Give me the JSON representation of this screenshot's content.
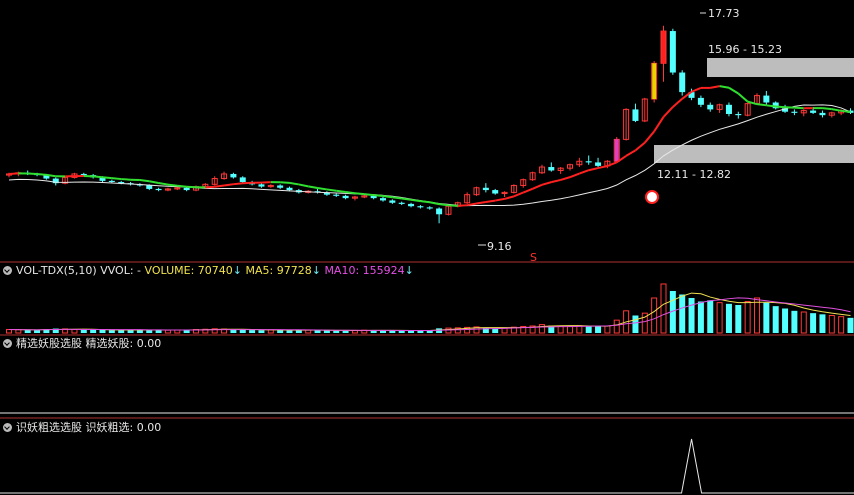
{
  "colors": {
    "up": "#ff3838",
    "down": "#54ffff",
    "ma_white": "#e8e8e8",
    "ma_yellow": "#f0e050",
    "ma_magenta": "#e050e0",
    "separator": "#b03030",
    "band": "#bdbdbd"
  },
  "price_pane": {
    "annotations": {
      "high": "17.73",
      "low": "9.16",
      "zone_upper": "15.96 - 15.23",
      "zone_lower": "12.11 - 12.82",
      "marker": "S"
    }
  },
  "volume_header": {
    "name": "VOL-TDX(5,10)",
    "vvol": "VVOL: -",
    "volume": "VOLUME: 70740",
    "ma5": "MA5: 97728",
    "ma10": "MA10: 155924"
  },
  "panel2_header": {
    "name": "精选妖股选股",
    "value": "精选妖股: 0.00"
  },
  "panel3_header": {
    "name": "识妖粗选选股",
    "value": "识妖粗选: 0.00"
  },
  "chart_data": {
    "type": "candlestick",
    "price_range": [
      8.0,
      18.5
    ],
    "candles": [
      [
        11.25,
        11.35,
        11.15,
        11.3
      ],
      [
        11.3,
        11.4,
        11.2,
        11.35
      ],
      [
        11.35,
        11.45,
        11.25,
        11.3
      ],
      [
        11.3,
        11.35,
        11.2,
        11.25
      ],
      [
        11.25,
        11.3,
        11.05,
        11.1
      ],
      [
        11.1,
        11.15,
        10.8,
        10.9
      ],
      [
        10.9,
        11.2,
        10.85,
        11.15
      ],
      [
        11.15,
        11.35,
        11.1,
        11.3
      ],
      [
        11.3,
        11.35,
        11.2,
        11.25
      ],
      [
        11.25,
        11.3,
        11.1,
        11.15
      ],
      [
        11.15,
        11.2,
        10.95,
        11.0
      ],
      [
        11.0,
        11.05,
        10.9,
        10.95
      ],
      [
        10.95,
        11.0,
        10.85,
        10.9
      ],
      [
        10.9,
        10.95,
        10.8,
        10.85
      ],
      [
        10.85,
        10.9,
        10.75,
        10.8
      ],
      [
        10.8,
        10.85,
        10.6,
        10.65
      ],
      [
        10.65,
        10.7,
        10.55,
        10.6
      ],
      [
        10.6,
        10.7,
        10.55,
        10.65
      ],
      [
        10.65,
        10.75,
        10.6,
        10.7
      ],
      [
        10.7,
        10.75,
        10.55,
        10.6
      ],
      [
        10.6,
        10.8,
        10.55,
        10.75
      ],
      [
        10.75,
        10.9,
        10.7,
        10.85
      ],
      [
        10.85,
        11.2,
        10.8,
        11.1
      ],
      [
        11.1,
        11.4,
        11.05,
        11.3
      ],
      [
        11.3,
        11.35,
        11.1,
        11.15
      ],
      [
        11.15,
        11.2,
        10.9,
        10.95
      ],
      [
        10.95,
        11.0,
        10.8,
        10.85
      ],
      [
        10.85,
        10.9,
        10.7,
        10.75
      ],
      [
        10.75,
        10.85,
        10.7,
        10.8
      ],
      [
        10.8,
        10.85,
        10.65,
        10.7
      ],
      [
        10.7,
        10.75,
        10.55,
        10.6
      ],
      [
        10.6,
        10.65,
        10.45,
        10.5
      ],
      [
        10.5,
        10.6,
        10.45,
        10.55
      ],
      [
        10.55,
        10.65,
        10.45,
        10.5
      ],
      [
        10.5,
        10.55,
        10.35,
        10.4
      ],
      [
        10.4,
        10.45,
        10.3,
        10.35
      ],
      [
        10.35,
        10.4,
        10.2,
        10.25
      ],
      [
        10.25,
        10.35,
        10.15,
        10.3
      ],
      [
        10.3,
        10.4,
        10.25,
        10.35
      ],
      [
        10.35,
        10.4,
        10.2,
        10.25
      ],
      [
        10.25,
        10.3,
        10.1,
        10.15
      ],
      [
        10.15,
        10.2,
        10.0,
        10.05
      ],
      [
        10.05,
        10.1,
        9.95,
        10.0
      ],
      [
        10.0,
        10.05,
        9.85,
        9.9
      ],
      [
        9.9,
        9.95,
        9.8,
        9.85
      ],
      [
        9.85,
        9.9,
        9.75,
        9.8
      ],
      [
        9.8,
        9.85,
        9.16,
        9.55
      ],
      [
        9.55,
        9.95,
        9.5,
        9.9
      ],
      [
        9.9,
        10.1,
        9.85,
        10.05
      ],
      [
        10.05,
        10.5,
        10.0,
        10.4
      ],
      [
        10.4,
        10.75,
        10.35,
        10.7
      ],
      [
        10.7,
        10.9,
        10.5,
        10.6
      ],
      [
        10.6,
        10.65,
        10.4,
        10.45
      ],
      [
        10.45,
        10.55,
        10.3,
        10.5
      ],
      [
        10.5,
        10.85,
        10.45,
        10.8
      ],
      [
        10.8,
        11.1,
        10.7,
        11.05
      ],
      [
        11.05,
        11.4,
        11.0,
        11.35
      ],
      [
        11.35,
        11.7,
        11.3,
        11.6
      ],
      [
        11.6,
        11.8,
        11.4,
        11.45
      ],
      [
        11.45,
        11.6,
        11.3,
        11.55
      ],
      [
        11.55,
        11.75,
        11.45,
        11.7
      ],
      [
        11.7,
        12.0,
        11.6,
        11.85
      ],
      [
        11.85,
        12.1,
        11.7,
        11.8
      ],
      [
        11.8,
        12.0,
        11.6,
        11.65
      ],
      [
        11.65,
        11.9,
        11.55,
        11.85
      ],
      [
        11.85,
        12.9,
        11.8,
        12.8
      ],
      [
        12.8,
        14.15,
        12.75,
        14.1
      ],
      [
        14.1,
        14.35,
        13.55,
        13.6
      ],
      [
        13.6,
        14.6,
        13.55,
        14.55
      ],
      [
        14.55,
        16.2,
        14.4,
        16.1
      ],
      [
        16.1,
        17.73,
        15.3,
        17.5
      ],
      [
        17.5,
        17.6,
        15.6,
        15.7
      ],
      [
        15.7,
        15.8,
        14.7,
        14.85
      ],
      [
        14.85,
        15.0,
        14.5,
        14.6
      ],
      [
        14.6,
        14.7,
        14.2,
        14.3
      ],
      [
        14.3,
        14.4,
        14.0,
        14.1
      ],
      [
        14.1,
        14.35,
        13.95,
        14.3
      ],
      [
        14.3,
        14.4,
        13.8,
        13.9
      ],
      [
        13.9,
        14.0,
        13.7,
        13.85
      ],
      [
        13.85,
        14.4,
        13.8,
        14.35
      ],
      [
        14.35,
        14.8,
        14.3,
        14.7
      ],
      [
        14.7,
        14.9,
        14.3,
        14.4
      ],
      [
        14.4,
        14.45,
        14.1,
        14.15
      ],
      [
        14.15,
        14.3,
        13.95,
        14.0
      ],
      [
        14.0,
        14.1,
        13.85,
        13.95
      ],
      [
        13.95,
        14.1,
        13.8,
        14.05
      ],
      [
        14.05,
        14.2,
        13.9,
        13.95
      ],
      [
        13.95,
        14.05,
        13.75,
        13.85
      ],
      [
        13.85,
        14.0,
        13.75,
        13.95
      ],
      [
        13.95,
        14.1,
        13.85,
        14.05
      ],
      [
        14.05,
        14.15,
        13.9,
        13.95
      ]
    ],
    "volume": [
      30000,
      28000,
      26000,
      25000,
      33000,
      38000,
      35000,
      30000,
      28000,
      27000,
      26000,
      25000,
      24000,
      26000,
      25000,
      27000,
      26000,
      24000,
      25000,
      28000,
      30000,
      32000,
      36000,
      34000,
      30000,
      27000,
      25000,
      24000,
      26000,
      25000,
      24000,
      23000,
      25000,
      24000,
      22000,
      21000,
      20000,
      22000,
      24000,
      23000,
      22000,
      21000,
      20000,
      22000,
      21000,
      24000,
      40000,
      42000,
      44000,
      48000,
      52000,
      46000,
      40000,
      42000,
      50000,
      56000,
      60000,
      72000,
      64000,
      60000,
      58000,
      62000,
      58000,
      56000,
      60000,
      110000,
      190000,
      150000,
      170000,
      300000,
      420000,
      360000,
      330000,
      300000,
      270000,
      280000,
      260000,
      250000,
      240000,
      270000,
      300000,
      260000,
      230000,
      210000,
      190000,
      180000,
      170000,
      160000,
      150000,
      140000,
      130000
    ],
    "panel3_values_nonzero_index": 73
  }
}
